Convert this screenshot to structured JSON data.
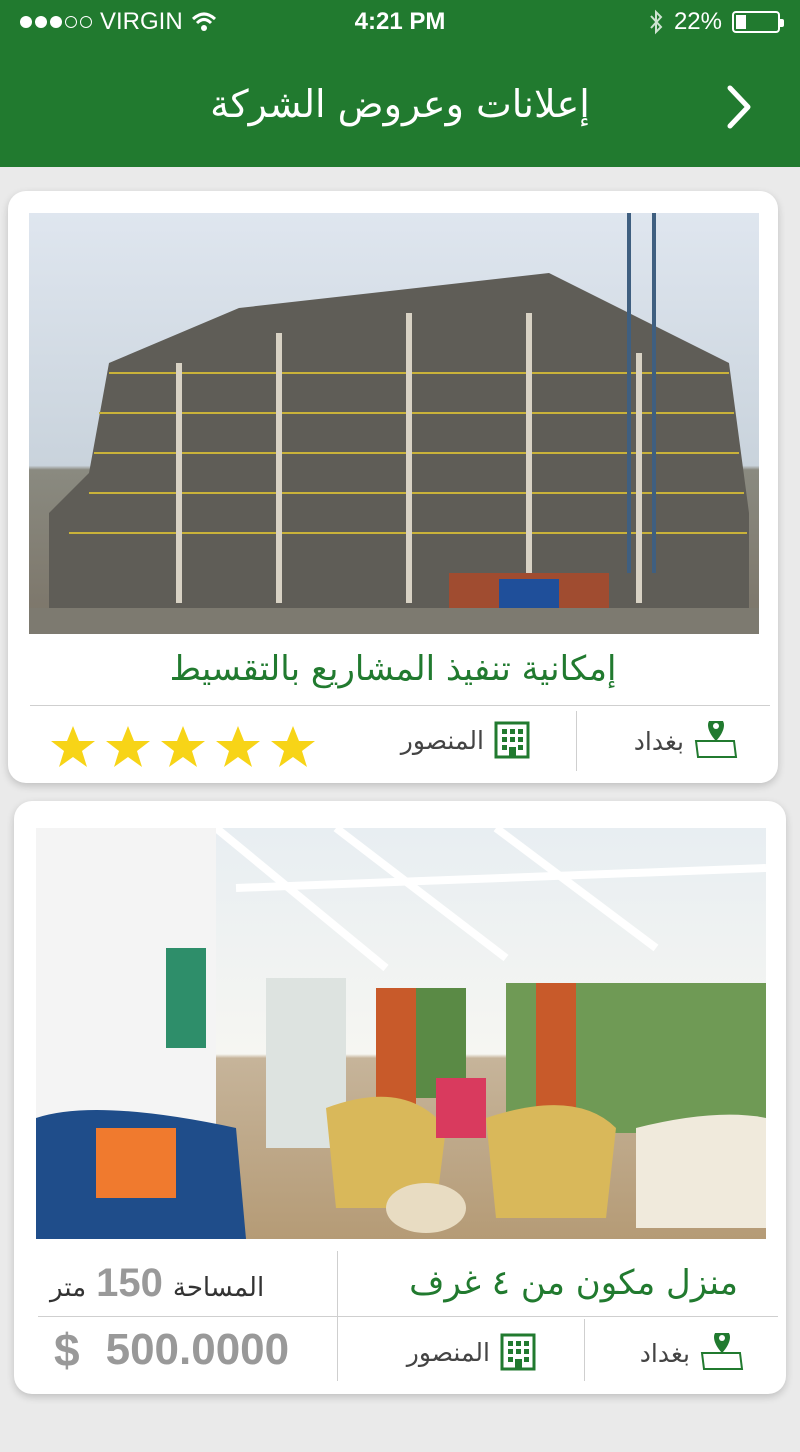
{
  "status_bar": {
    "carrier": "VIRGIN",
    "time": "4:21 PM",
    "battery": "22%",
    "battery_level": 0.22
  },
  "nav": {
    "title": "إعلانات وعروض الشركة",
    "back_icon": "chevron-right-icon"
  },
  "listings": [
    {
      "title": "إمكانية تنفيذ المشاريع بالتقسيط",
      "city": "بغداد",
      "district": "المنصور",
      "rating": 5,
      "rating_max": 5
    },
    {
      "title": "منزل مكون من ٤ غرف",
      "area_label": "المساحة",
      "area_value": "150",
      "area_unit": "متر",
      "price": "500.0000",
      "currency": "$",
      "city": "بغداد",
      "district": "المنصور"
    }
  ],
  "colors": {
    "brand_green": "#217a2f",
    "star_yellow": "#f7d417"
  }
}
